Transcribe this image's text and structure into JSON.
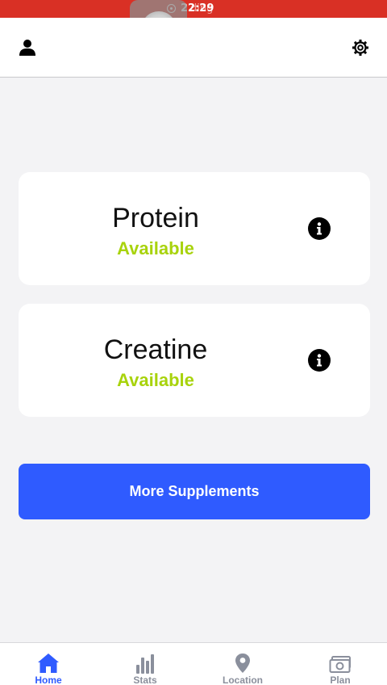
{
  "status_bar": {
    "time": "22:29",
    "recording_text": "ding"
  },
  "header": {
    "left_icon": "person-icon",
    "right_icon": "gear-icon"
  },
  "cards": [
    {
      "name": "Protein",
      "status": "Available",
      "info_icon": "info-icon"
    },
    {
      "name": "Creatine",
      "status": "Available",
      "info_icon": "info-icon"
    }
  ],
  "more_button": {
    "label": "More Supplements"
  },
  "bottom_nav": {
    "items": [
      {
        "label": "Home",
        "icon": "home-icon",
        "active": true
      },
      {
        "label": "Stats",
        "icon": "bar-chart-icon",
        "active": false
      },
      {
        "label": "Location",
        "icon": "map-pin-icon",
        "active": false
      },
      {
        "label": "Plan",
        "icon": "money-icon",
        "active": false
      }
    ]
  },
  "colors": {
    "status_bar": "#d93025",
    "accent": "#2f5bff",
    "available": "#a8d30c",
    "inactive_nav": "#8a8f9c"
  }
}
